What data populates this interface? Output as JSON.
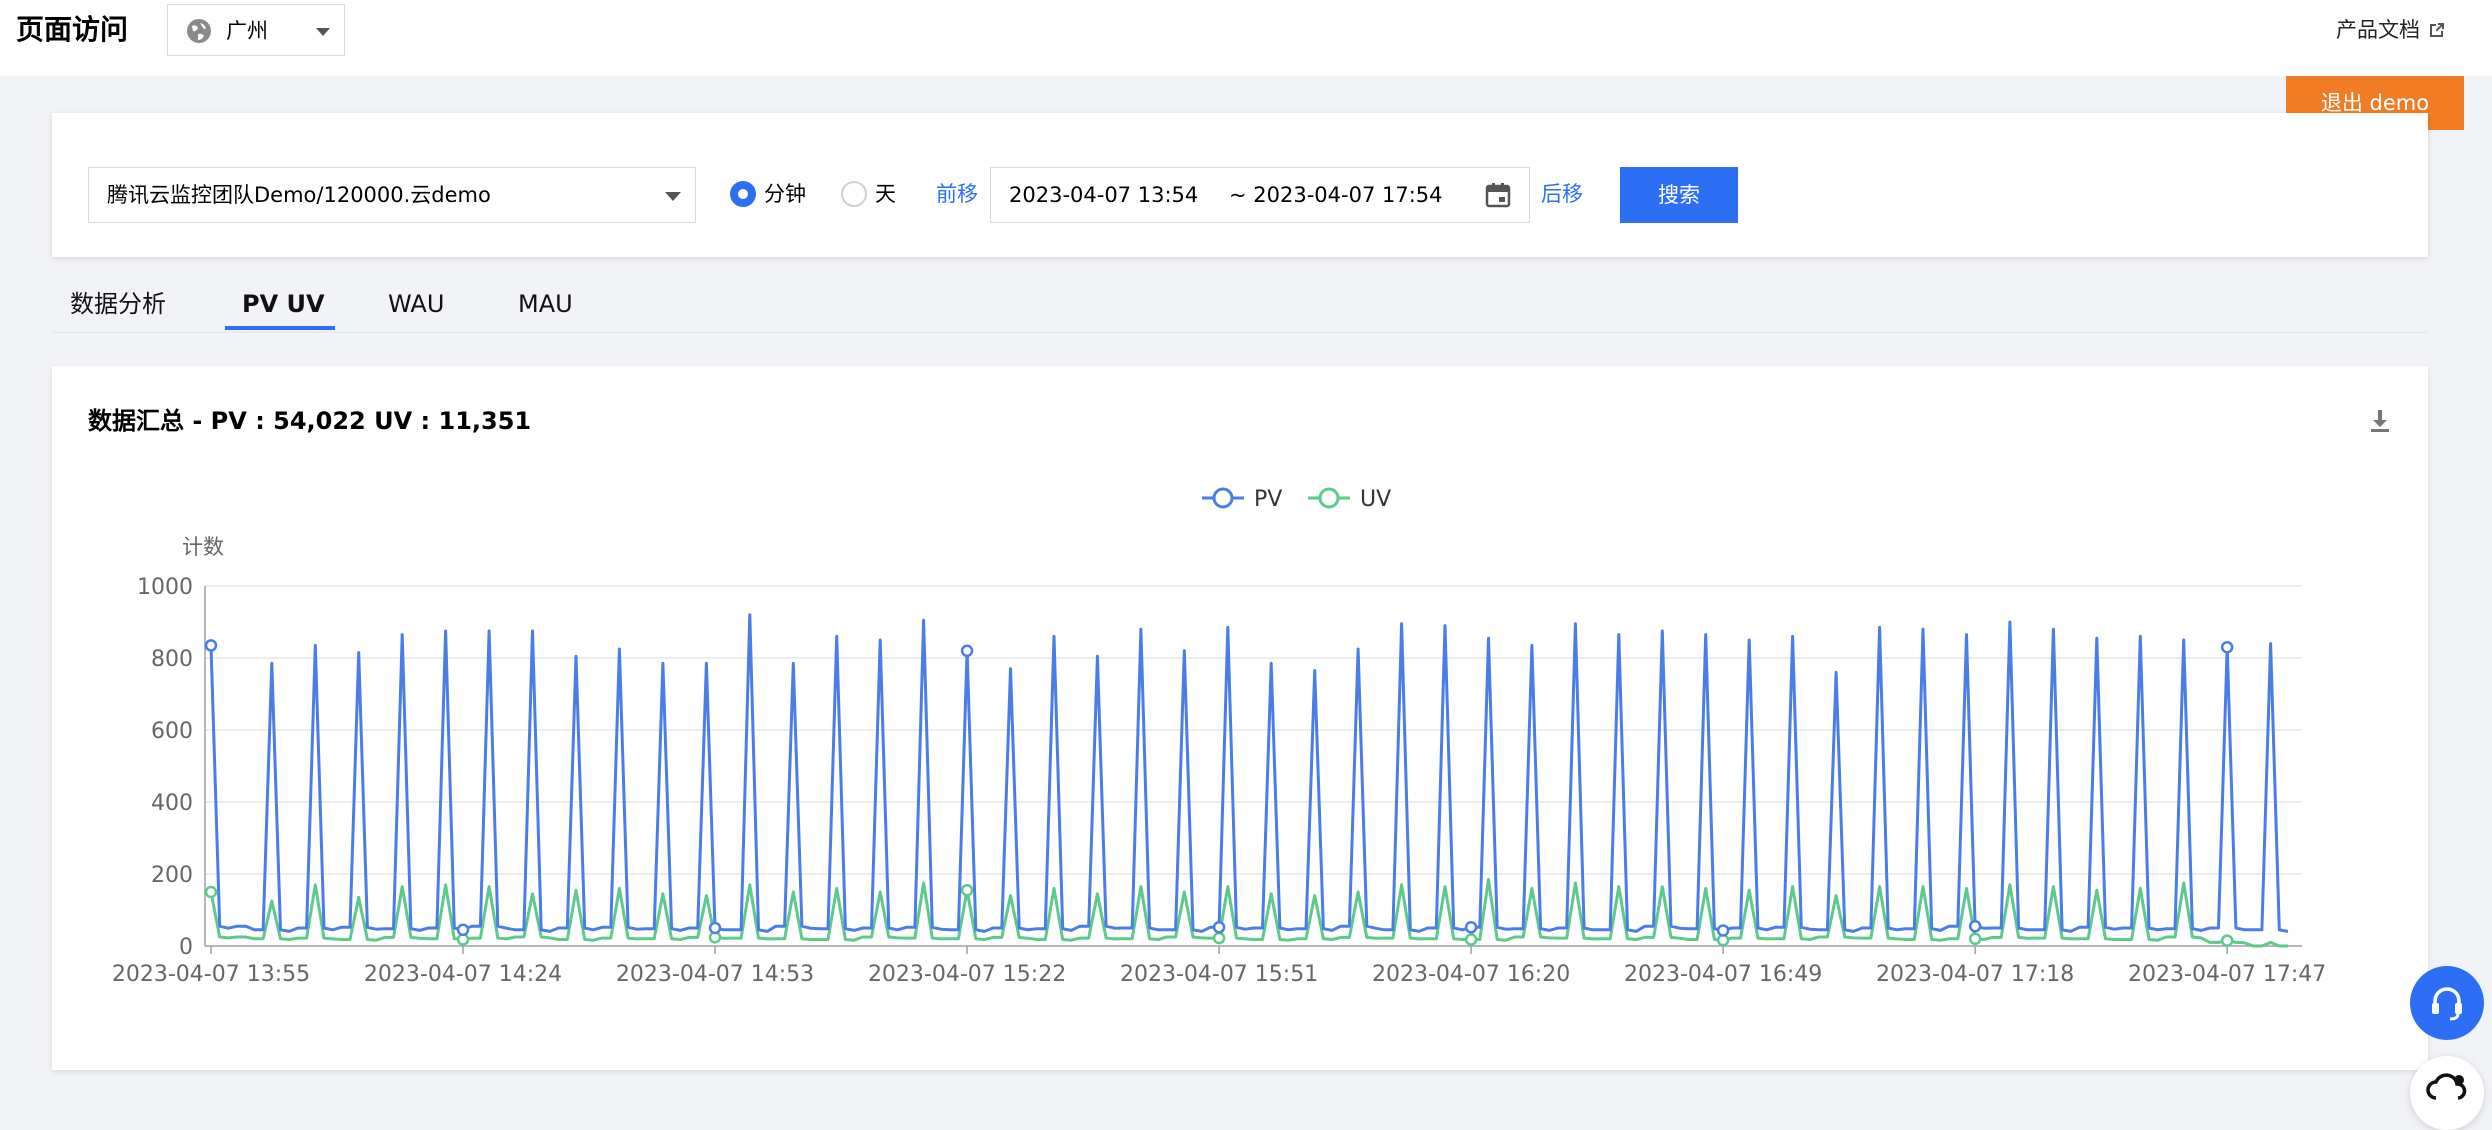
{
  "header": {
    "title": "页面访问",
    "region": "广州",
    "docs_label": "产品文档",
    "exit_demo_label": "退出 demo"
  },
  "filters": {
    "instance": "腾讯云监控团队Demo/120000.云demo",
    "granularity": [
      {
        "label": "分钟",
        "selected": true
      },
      {
        "label": "天",
        "selected": false
      }
    ],
    "prev_label": "前移",
    "next_label": "后移",
    "start_time": "2023-04-07 13:54",
    "end_time": "~ 2023-04-07 17:54",
    "search_label": "搜索"
  },
  "tabs": [
    {
      "label": "数据分析",
      "active": false
    },
    {
      "label": "PV UV",
      "active": true
    },
    {
      "label": "WAU",
      "active": false
    },
    {
      "label": "MAU",
      "active": false
    }
  ],
  "summary": {
    "prefix": "数据汇总 - ",
    "pv": "PV : 54,022",
    "uv": "UV : 11,351"
  },
  "colors": {
    "accent": "#2c6ff5",
    "pv": "#4a7de8",
    "uv": "#5dc98a",
    "exit": "#f07c26"
  },
  "chart_data": {
    "type": "line",
    "legend": [
      "PV",
      "UV"
    ],
    "legend_position": "top-center",
    "ylabel": "计数",
    "ylim": [
      0,
      1000
    ],
    "yticks": [
      0,
      200,
      400,
      600,
      800,
      1000
    ],
    "x_tick_labels": [
      "2023-04-07 13:55",
      "2023-04-07 14:24",
      "2023-04-07 14:53",
      "2023-04-07 15:22",
      "2023-04-07 15:51",
      "2023-04-07 16:20",
      "2023-04-07 16:49",
      "2023-04-07 17:18",
      "2023-04-07 17:47"
    ],
    "grid": "horizontal",
    "x_start": "2023-04-07 13:55",
    "x_end": "2023-04-07 17:54",
    "interval_minutes": 1,
    "series": [
      {
        "name": "PV",
        "peaks": [
          835,
          785,
          835,
          815,
          865,
          875,
          875,
          875,
          805,
          825,
          785,
          785,
          920,
          785,
          860,
          850,
          905,
          820,
          770,
          860,
          805,
          880,
          820,
          885,
          785,
          765,
          825,
          895,
          890,
          855,
          835,
          895,
          865,
          875,
          865,
          850,
          860,
          760,
          885,
          880,
          865,
          900,
          880,
          855,
          860,
          850,
          830,
          840
        ],
        "base": [
          55,
          45,
          50,
          52,
          48,
          50,
          55,
          45,
          50,
          52,
          48,
          50,
          45,
          55,
          48,
          50,
          52,
          45,
          50,
          48,
          55,
          50,
          45,
          52,
          50,
          48,
          55,
          45,
          50,
          52,
          48,
          50,
          45,
          55,
          48,
          50,
          52,
          45,
          50,
          48,
          55,
          50,
          45,
          52,
          50,
          48,
          50,
          45
        ],
        "values": []
      },
      {
        "name": "UV",
        "peaks": [
          150,
          125,
          170,
          135,
          165,
          170,
          165,
          145,
          155,
          160,
          145,
          140,
          170,
          150,
          160,
          150,
          175,
          155,
          140,
          160,
          145,
          165,
          150,
          165,
          145,
          140,
          150,
          170,
          165,
          185,
          160,
          175,
          165,
          165,
          160,
          155,
          165,
          140,
          165,
          165,
          160,
          170,
          165,
          155,
          160,
          175,
          15,
          10
        ],
        "base": [
          25,
          20,
          22,
          18,
          24,
          20,
          22,
          25,
          18,
          22,
          20,
          24,
          22,
          20,
          18,
          25,
          22,
          20,
          24,
          18,
          22,
          20,
          25,
          22,
          18,
          20,
          24,
          22,
          20,
          18,
          25,
          22,
          20,
          24,
          18,
          22,
          20,
          25,
          22,
          18,
          20,
          24,
          22,
          20,
          18,
          25,
          10,
          0
        ],
        "values": []
      }
    ]
  }
}
